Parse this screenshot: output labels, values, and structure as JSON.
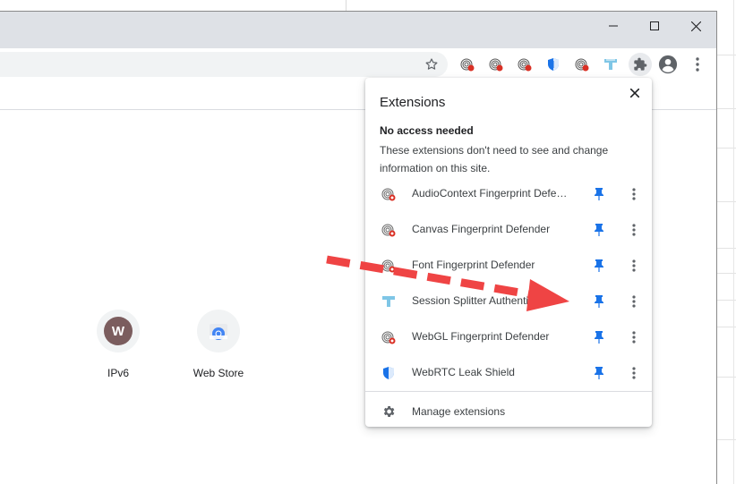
{
  "window_controls": {
    "minimize": "minimize-icon",
    "maximize": "maximize-icon",
    "close": "close-icon"
  },
  "toolbar": {
    "icons": [
      "star-icon",
      "audiocontext-defender-icon",
      "canvas-defender-icon",
      "font-defender-icon",
      "webrtc-shield-icon",
      "webgl-defender-icon",
      "session-splitter-icon",
      "extensions-puzzle-icon",
      "profile-avatar-icon",
      "chrome-menu-icon"
    ]
  },
  "shortcuts": [
    {
      "letter": "W",
      "label": "IPv6"
    },
    {
      "label": "Web Store"
    }
  ],
  "extensions_popup": {
    "title": "Extensions",
    "section_title": "No access needed",
    "section_desc": "These extensions don't need to see and change information on this site.",
    "items": [
      {
        "name": "AudioContext Fingerprint Defender",
        "icon": "fingerprint-icon"
      },
      {
        "name": "Canvas Fingerprint Defender",
        "icon": "fingerprint-icon"
      },
      {
        "name": "Font Fingerprint Defender",
        "icon": "fingerprint-icon"
      },
      {
        "name": "Session Splitter Authentication",
        "icon": "session-splitter-icon"
      },
      {
        "name": "WebGL Fingerprint Defender",
        "icon": "fingerprint-icon"
      },
      {
        "name": "WebRTC Leak Shield",
        "icon": "shield-icon"
      }
    ],
    "manage_label": "Manage extensions"
  },
  "colors": {
    "pin": "#1a73e8",
    "arrow": "#ef4444",
    "titlebar": "#dee1e6"
  }
}
